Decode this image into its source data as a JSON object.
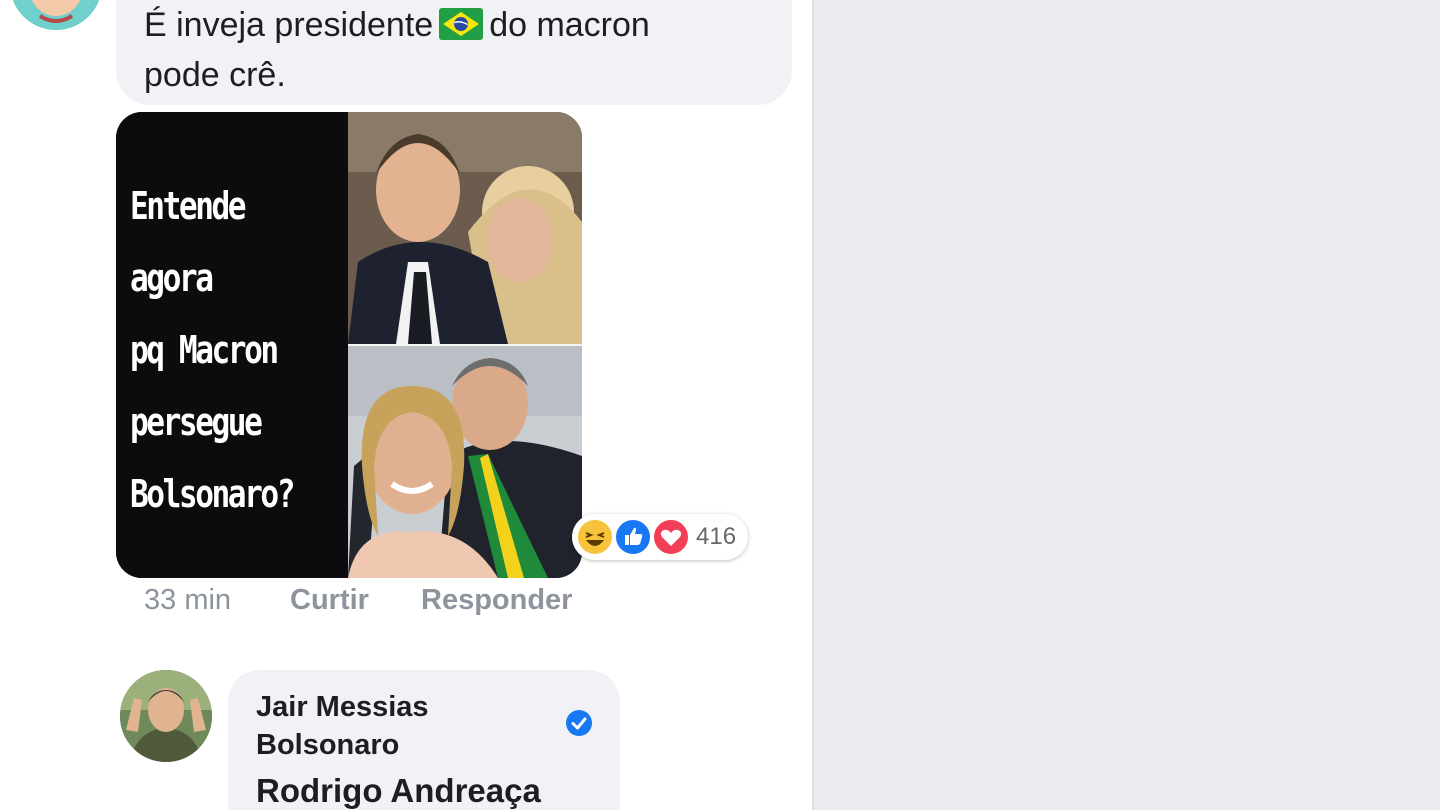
{
  "comment1": {
    "text_before_flag": "É inveja presidente",
    "flag_icon": "brazil-flag-icon",
    "text_after_flag": "do macron",
    "text_line2": "pode crê.",
    "meme": {
      "lines": [
        "Entende",
        "agora",
        "pq Macron",
        "persegue",
        "Bolsonaro?"
      ]
    },
    "reactions": {
      "icons": [
        "haha-icon",
        "like-icon",
        "love-icon"
      ],
      "count": "416"
    },
    "meta": {
      "time": "33 min",
      "like_label": "Curtir",
      "reply_label": "Responder"
    }
  },
  "comment2": {
    "author": "Jair Messias Bolsonaro",
    "verified_icon": "verified-badge-icon",
    "mention": "Rodrigo Andreaça"
  },
  "colors": {
    "feed_bg": "#ffffff",
    "side_bg": "#e9ebee",
    "bubble_bg": "#f0f2f5",
    "meta_text": "#8d949e",
    "verified": "#1877f2"
  }
}
